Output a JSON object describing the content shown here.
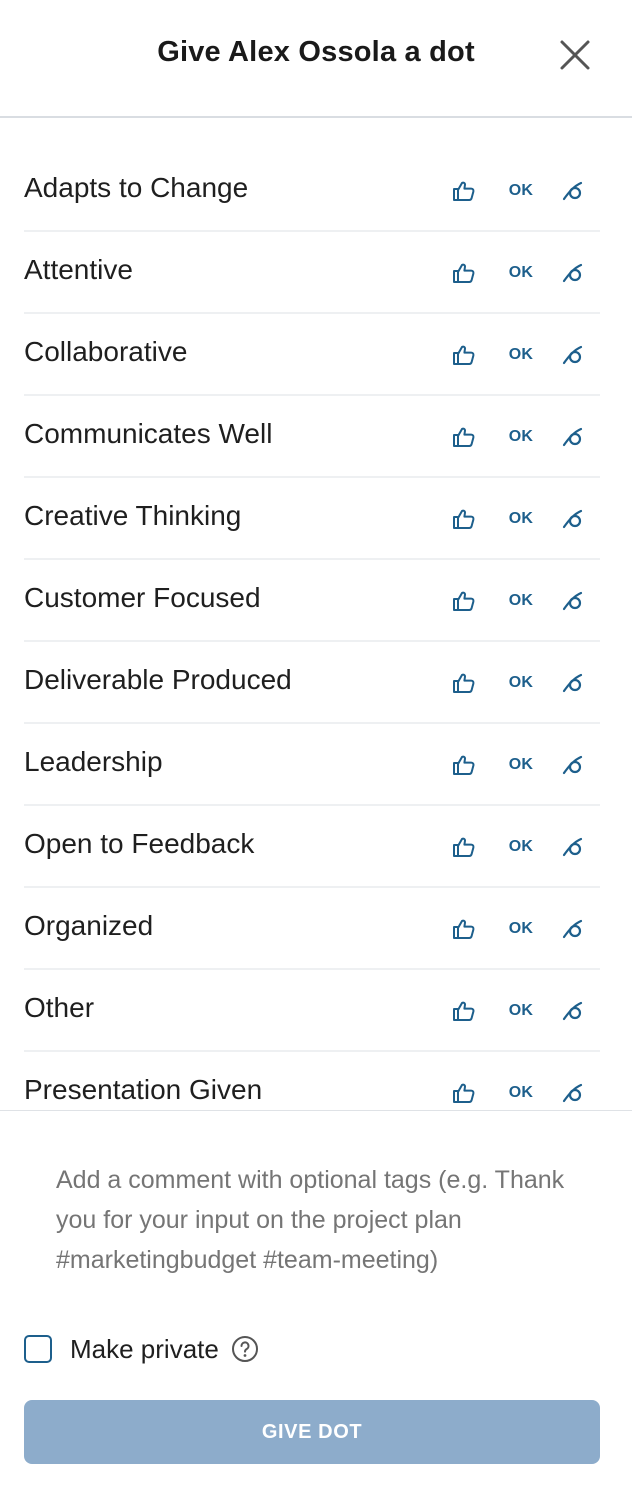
{
  "header": {
    "title": "Give Alex Ossola a dot",
    "close_icon": "close-icon"
  },
  "attributes": [
    {
      "label": "Adapts to Change",
      "ok_label": "OK"
    },
    {
      "label": "Attentive",
      "ok_label": "OK"
    },
    {
      "label": "Collaborative",
      "ok_label": "OK"
    },
    {
      "label": "Communicates Well",
      "ok_label": "OK"
    },
    {
      "label": "Creative Thinking",
      "ok_label": "OK"
    },
    {
      "label": "Customer Focused",
      "ok_label": "OK"
    },
    {
      "label": "Deliverable Produced",
      "ok_label": "OK"
    },
    {
      "label": "Leadership",
      "ok_label": "OK"
    },
    {
      "label": "Open to Feedback",
      "ok_label": "OK"
    },
    {
      "label": "Organized",
      "ok_label": "OK"
    },
    {
      "label": "Other",
      "ok_label": "OK"
    },
    {
      "label": "Presentation Given",
      "ok_label": "OK"
    }
  ],
  "comment": {
    "placeholder": "Add a comment with optional tags (e.g. Thank you for your input on the project plan #marketingbudget #team-meeting)",
    "value": ""
  },
  "private": {
    "label": "Make private",
    "checked": false
  },
  "submit": {
    "label": "GIVE DOT"
  },
  "colors": {
    "accent": "#1d5f8c",
    "button_disabled": "#8daccb",
    "placeholder": "#a3acb5"
  }
}
